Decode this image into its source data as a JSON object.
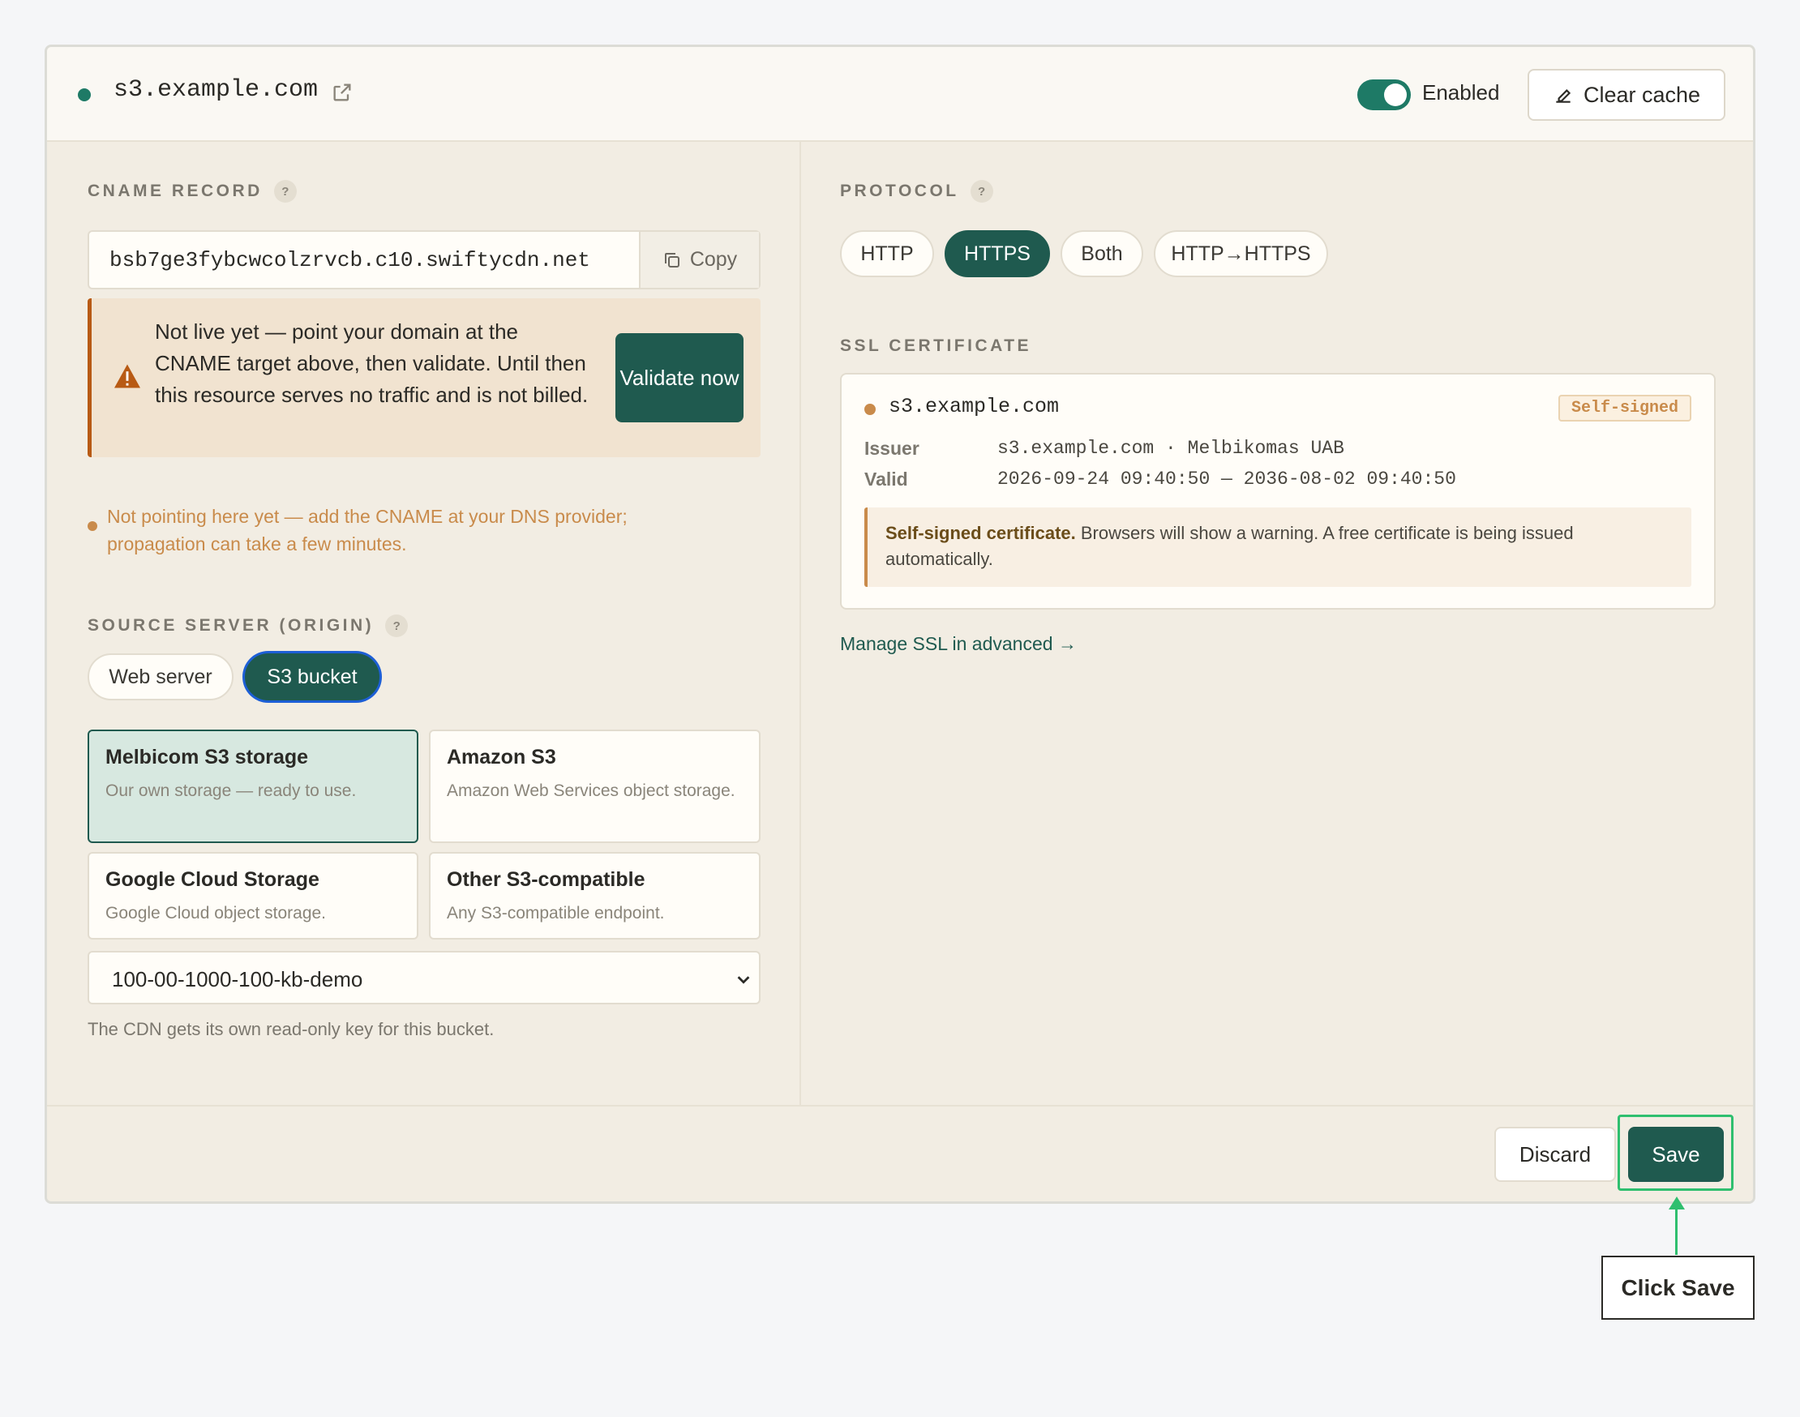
{
  "header": {
    "domain": "s3.example.com",
    "toggle_label": "Enabled",
    "toggle_on": true,
    "clear_cache_label": "Clear cache"
  },
  "cname": {
    "label": "CNAME RECORD",
    "value": "bsb7ge3fybcwcolzrvcb.c10.swiftycdn.net",
    "copy_label": "Copy",
    "warning_text": "Not live yet — point your domain at the CNAME target above, then validate. Until then this resource serves no traffic and is not billed.",
    "validate_label": "Validate now",
    "pending_text": "Not pointing here yet — add the CNAME at your DNS provider; propagation can take a few minutes."
  },
  "origin": {
    "label": "SOURCE SERVER (ORIGIN)",
    "types": [
      "Web server",
      "S3 bucket"
    ],
    "selected_type": "S3 bucket",
    "options": [
      {
        "title": "Melbicom S3 storage",
        "desc": "Our own storage — ready to use."
      },
      {
        "title": "Amazon S3",
        "desc": "Amazon Web Services object storage."
      },
      {
        "title": "Google Cloud Storage",
        "desc": "Google Cloud object storage."
      },
      {
        "title": "Other S3-compatible",
        "desc": "Any S3-compatible endpoint."
      }
    ],
    "selected_option": "Melbicom S3 storage",
    "bucket": "100-00-1000-100-kb-demo",
    "note": "The CDN gets its own read-only key for this bucket."
  },
  "protocol": {
    "label": "PROTOCOL",
    "options": [
      "HTTP",
      "HTTPS",
      "Both",
      "HTTP→HTTPS"
    ],
    "selected": "HTTPS"
  },
  "ssl": {
    "label": "SSL CERTIFICATE",
    "domain": "s3.example.com",
    "badge": "Self-signed",
    "issuer_key": "Issuer",
    "issuer": "s3.example.com · Melbikomas UAB",
    "valid_key": "Valid",
    "valid": "2026-09-24 09:40:50 — 2036-08-02 09:40:50",
    "note_bold": "Self-signed certificate.",
    "note_text": " Browsers will show a warning. A free certificate is being issued automatically.",
    "manage_link": "Manage SSL in advanced →"
  },
  "footer": {
    "discard_label": "Discard",
    "save_label": "Save"
  },
  "callout": {
    "text": "Click Save",
    "color": "#2fbf6f"
  },
  "colors": {
    "accent": "#1f5a4f",
    "status_ok": "#1e7a66",
    "warning": "#b85a14",
    "pending": "#c98b4b"
  }
}
